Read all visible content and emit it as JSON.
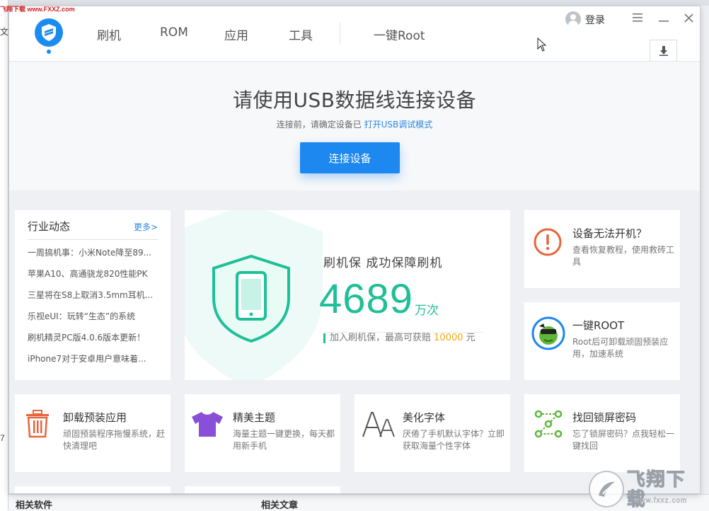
{
  "background": {
    "watermark": "飞翔下载 www.FXXZ.com",
    "left_chars": [
      "文",
      "7"
    ],
    "bottom_tabs": [
      "相关软件",
      "相关文章"
    ]
  },
  "header": {
    "nav": [
      "刷机",
      "ROM",
      "应用",
      "工具",
      "一键Root"
    ],
    "login": "登录"
  },
  "connect": {
    "title": "请使用USB数据线连接设备",
    "subtitle_prefix": "连接前，请确定设备已",
    "subtitle_link": "打开USB调试模式",
    "button": "连接设备"
  },
  "news": {
    "title": "行业动态",
    "more": "更多>",
    "items": [
      "一周搞机事：小米Note降至89...",
      "苹果A10、高通骁龙820性能PK",
      "三星将在S8上取消3.5mm耳机...",
      "乐视eUI：玩转“生态”的系统",
      "刷机精灵PC版4.0.6版本更新！",
      "iPhone7对于安卓用户意味着..."
    ]
  },
  "guarantee": {
    "title": "刷机保  成功保障刷机",
    "count": "4689",
    "unit": "万次",
    "note_prefix": "加入刷机保，最高可获赔",
    "amount": "10000",
    "note_suffix": "元"
  },
  "side_cards": [
    {
      "title": "设备无法开机？",
      "desc": "查看恢复教程，使用救砖工具",
      "icon": "warning-icon"
    },
    {
      "title": "一键ROOT",
      "desc": "Root后可卸载顽固预装应用，加速系统",
      "icon": "root-mascot-icon"
    }
  ],
  "feature_cards": [
    {
      "title": "卸载预装应用",
      "desc": "顽固预装程序拖慢系统，赶快清理吧",
      "icon": "trash-icon"
    },
    {
      "title": "精美主题",
      "desc": "海量主题一键更换，每天都用新手机",
      "icon": "tshirt-icon"
    },
    {
      "title": "美化字体",
      "desc": "厌倦了手机默认字体？立即获取海量个性字体",
      "icon": "font-icon"
    },
    {
      "title": "找回锁屏密码",
      "desc": "忘了锁屏密码？点我轻松一键找回",
      "icon": "pattern-lock-icon"
    }
  ],
  "site_badge": {
    "name": "飞翔下载",
    "url": "www.fxxz.com"
  },
  "colors": {
    "primary": "#1c88f0",
    "accent_green": "#1fbf98",
    "amount_orange": "#f0a80d",
    "warning_red": "#e8643c",
    "theme_purple": "#8a4fd8"
  }
}
